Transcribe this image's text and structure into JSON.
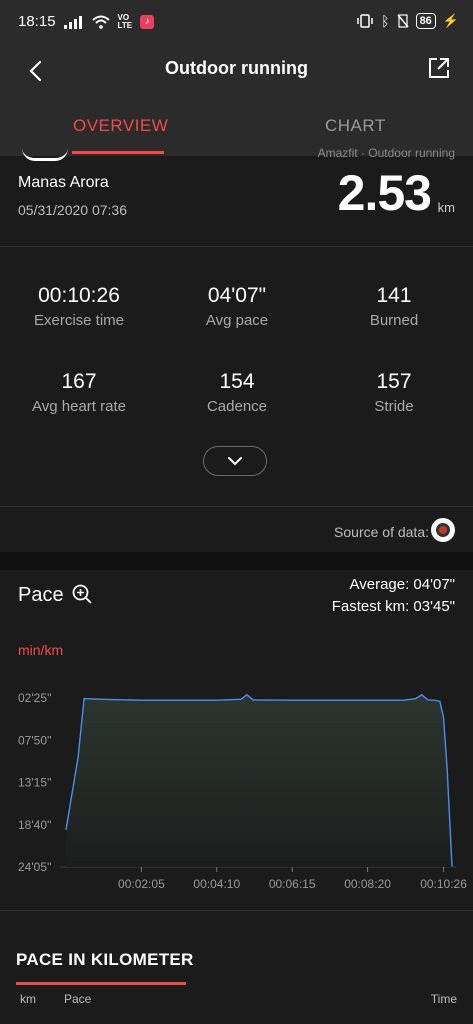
{
  "status": {
    "time": "18:15",
    "net_badge_top": "VO",
    "net_badge_bottom": "LTE",
    "battery": "86"
  },
  "header": {
    "title": "Outdoor running",
    "tabs": [
      {
        "label": "OVERVIEW",
        "active": true
      },
      {
        "label": "CHART",
        "active": false
      }
    ]
  },
  "summary": {
    "partial_label": "Amazfit · Outdoor running",
    "user_name": "Manas Arora",
    "date": "05/31/2020 07:36",
    "distance": "2.53",
    "distance_unit": "km",
    "stats": [
      {
        "value": "00:10:26",
        "label": "Exercise time"
      },
      {
        "value": "04'07\"",
        "label": "Avg pace"
      },
      {
        "value": "141",
        "label": "Burned"
      },
      {
        "value": "167",
        "label": "Avg heart rate"
      },
      {
        "value": "154",
        "label": "Cadence"
      },
      {
        "value": "157",
        "label": "Stride"
      }
    ],
    "source_label": "Source of data:"
  },
  "pace": {
    "title": "Pace",
    "average": "Average: 04'07\"",
    "fastest": "Fastest km: 03'45\"",
    "unit": "min/km"
  },
  "chart_data": {
    "type": "area",
    "title": "",
    "xlabel": "",
    "ylabel": "min/km",
    "y_ticks": [
      "02'25''",
      "07'50''",
      "13'15''",
      "18'40''",
      "24'05''"
    ],
    "x_ticks": [
      "00:02:05",
      "00:04:10",
      "00:06:15",
      "00:08:20",
      "00:10:26"
    ],
    "x_seconds": [
      0,
      20,
      30,
      60,
      125,
      200,
      250,
      290,
      300,
      310,
      375,
      450,
      500,
      560,
      580,
      590,
      600,
      610,
      620,
      626,
      632,
      640
    ],
    "y_pace_seconds": [
      1160,
      600,
      150,
      155,
      162,
      162,
      162,
      155,
      120,
      160,
      162,
      162,
      162,
      162,
      150,
      120,
      160,
      162,
      170,
      300,
      700,
      1440
    ],
    "series_color": "#4a8ff0"
  },
  "km_table": {
    "title": "PACE IN KILOMETER",
    "columns": [
      "km",
      "Pace",
      "Time"
    ]
  }
}
